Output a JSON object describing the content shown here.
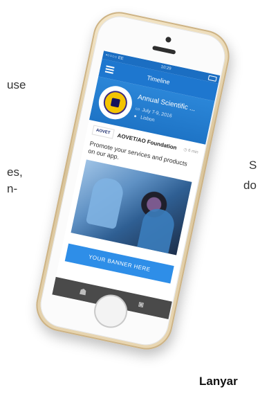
{
  "background": {
    "fragment_left_1": "use",
    "fragment_left_2": "es,",
    "fragment_left_3": "n-",
    "fragment_right_1": "S",
    "fragment_right_2": "do",
    "fragment_bottom": "Lanyar"
  },
  "statusbar": {
    "carrier": "•○○○○ EE",
    "time": "10:29"
  },
  "appbar": {
    "title": "Timeline"
  },
  "event": {
    "title": "Annual Scientific ...",
    "date": "July 7-9, 2016",
    "location": "Lisbon"
  },
  "post": {
    "logo_text": "AOVET",
    "organization": "AOVET/AO Foundation",
    "time": "6 min",
    "text": "Promote your services and products on our app."
  },
  "banner": {
    "label": "YOUR BANNER HERE"
  },
  "icons": {
    "menu": "hamburger-icon",
    "calendar": "calendar-icon",
    "location": "location-pin-icon",
    "clock": "clock-icon",
    "tab_left": "helmet-icon",
    "tab_right": "camera-icon"
  }
}
